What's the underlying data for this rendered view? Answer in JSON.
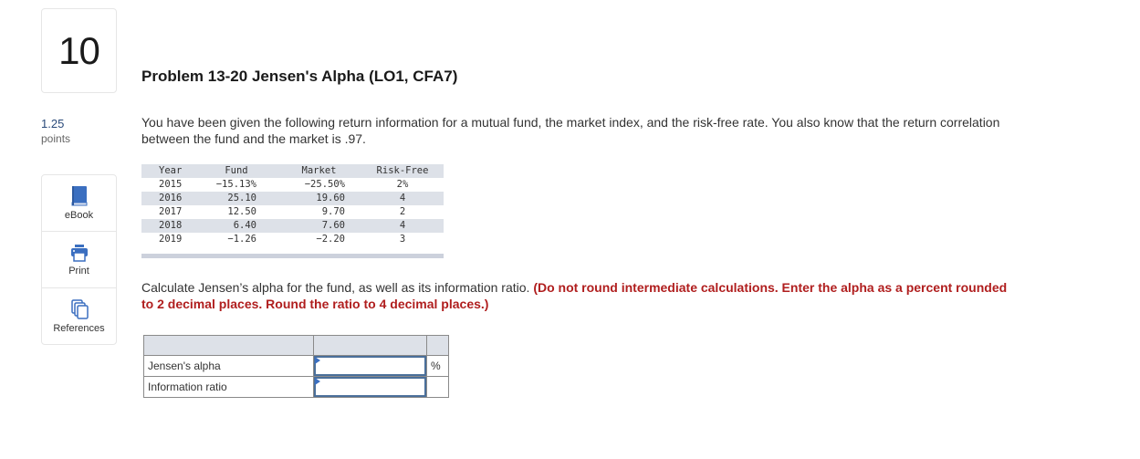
{
  "question": {
    "number": "10",
    "points_value": "1.25",
    "points_label": "points"
  },
  "tools": [
    {
      "label": "eBook",
      "icon": "book-icon"
    },
    {
      "label": "Print",
      "icon": "printer-icon"
    },
    {
      "label": "References",
      "icon": "documents-icon"
    }
  ],
  "problem": {
    "title": "Problem 13-20 Jensen's Alpha (LO1, CFA7)",
    "intro": "You have been given the following return information for a mutual fund, the market index, and the risk-free rate. You also know that the return correlation between the fund and the market is .97."
  },
  "returns_table": {
    "headers": [
      "Year",
      "Fund",
      "Market",
      "Risk-Free"
    ],
    "rows": [
      [
        "2015",
        "−15.13%",
        "−25.50%",
        "2%"
      ],
      [
        "2016",
        "25.10",
        "19.60",
        "4"
      ],
      [
        "2017",
        "12.50",
        "9.70",
        "2"
      ],
      [
        "2018",
        "6.40",
        "7.60",
        "4"
      ],
      [
        "2019",
        "−1.26",
        "−2.20",
        "3"
      ]
    ]
  },
  "instructions": {
    "text": "Calculate Jensen’s alpha for the fund, as well as its information ratio. ",
    "hint": "(Do not round intermediate calculations. Enter the alpha as a percent rounded to 2 decimal places. Round the ratio to 4 decimal places.)"
  },
  "answer_table": {
    "rows": [
      {
        "label": "Jensen's alpha",
        "value": "",
        "unit": "%"
      },
      {
        "label": "Information ratio",
        "value": "",
        "unit": ""
      }
    ]
  },
  "colors": {
    "hint_red": "#b01e1e",
    "table_shade": "#dde1e8",
    "input_border": "#4a6f9a",
    "icon_blue": "#3b6fc0"
  }
}
